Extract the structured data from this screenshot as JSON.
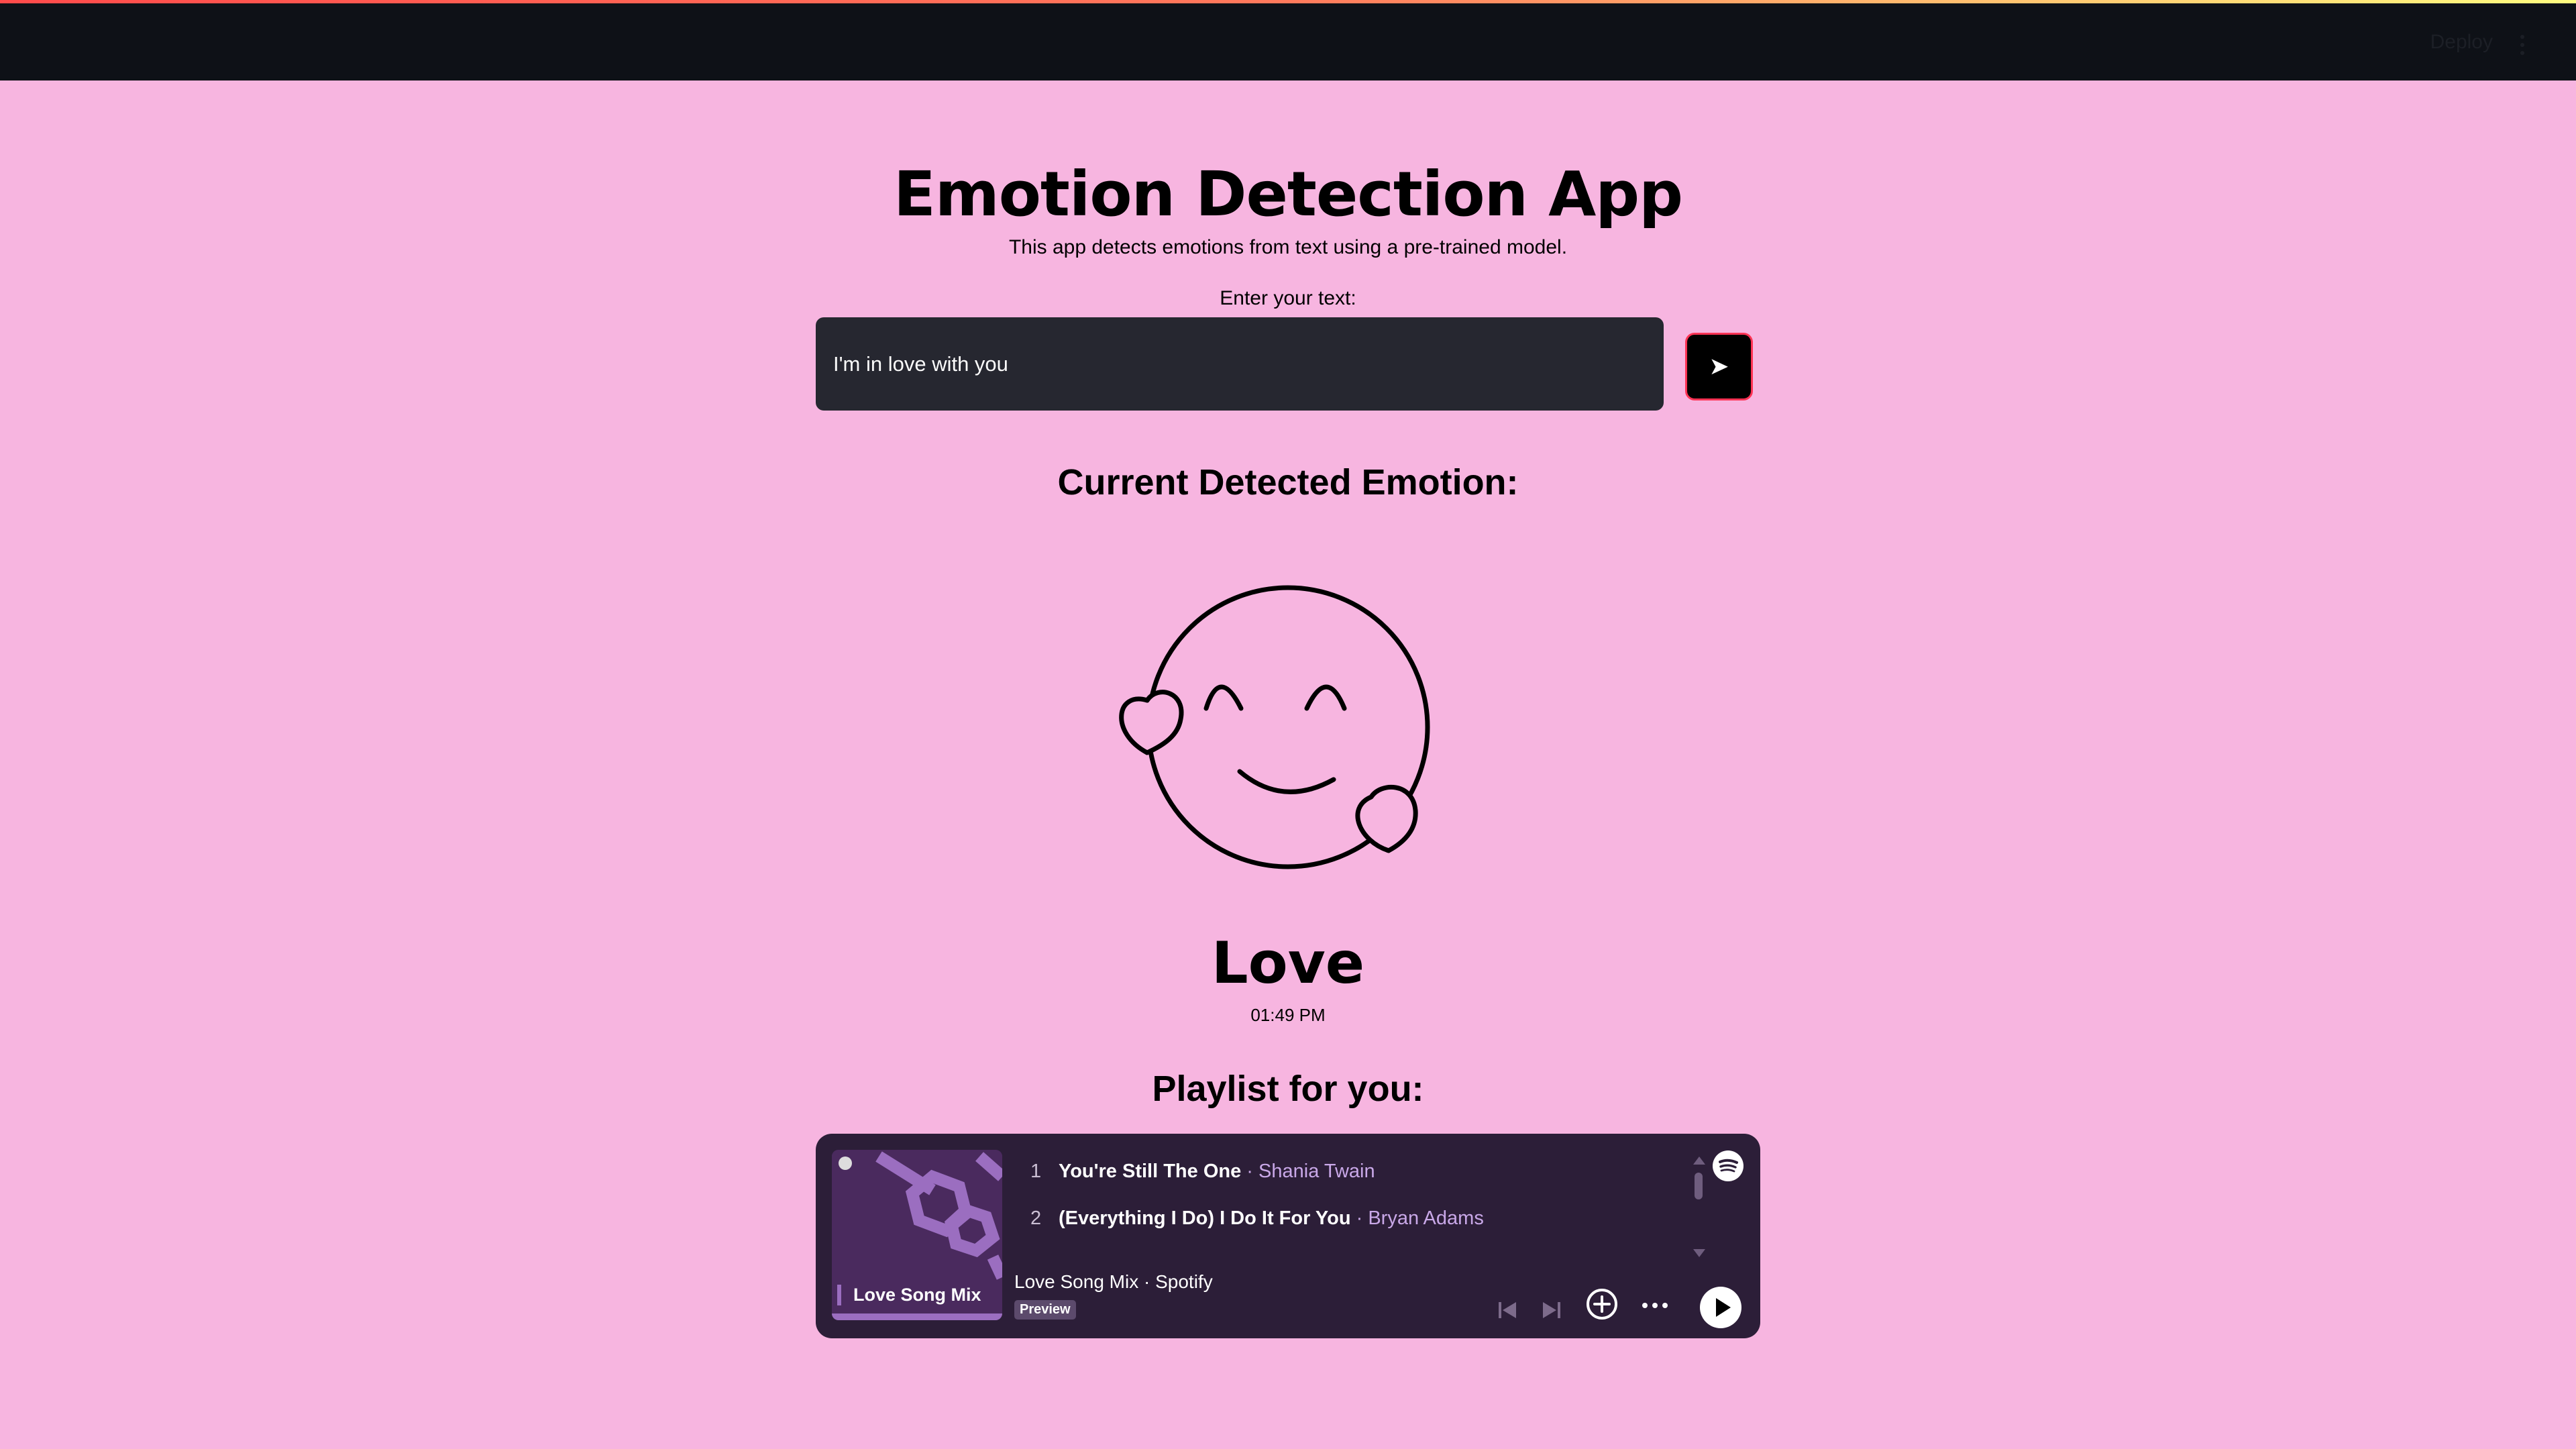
{
  "header": {
    "deploy_label": "Deploy",
    "menu_icon": "vertical-dots-icon"
  },
  "app": {
    "title": "Emotion Detection App",
    "subtitle": "This app detects emotions from text using a pre-trained model.",
    "input_label": "Enter your text:",
    "input_value": "I'm in love with you",
    "send_icon": "send-arrow-icon",
    "send_glyph": "➤"
  },
  "emotion": {
    "heading": "Current Detected Emotion:",
    "icon": "smiling-face-with-hearts-icon",
    "name": "Love",
    "time": "01:49 PM"
  },
  "playlist": {
    "heading": "Playlist for you:",
    "cover_title": "Love Song Mix",
    "tracks": [
      {
        "num": "1",
        "title": "You're Still The One",
        "sep": "·",
        "artist": "Shania Twain"
      },
      {
        "num": "2",
        "title": "(Everything I Do) I Do It For You",
        "sep": "·",
        "artist": "Bryan Adams"
      }
    ],
    "meta": "Love Song Mix · Spotify",
    "badge": "Preview"
  },
  "colors": {
    "background": "#f7b5e0",
    "header": "#0e1117",
    "input_bg": "#262730",
    "send_border": "#ff3355",
    "player_bg": "#2c1e38",
    "artist": "#c9a8e8"
  }
}
